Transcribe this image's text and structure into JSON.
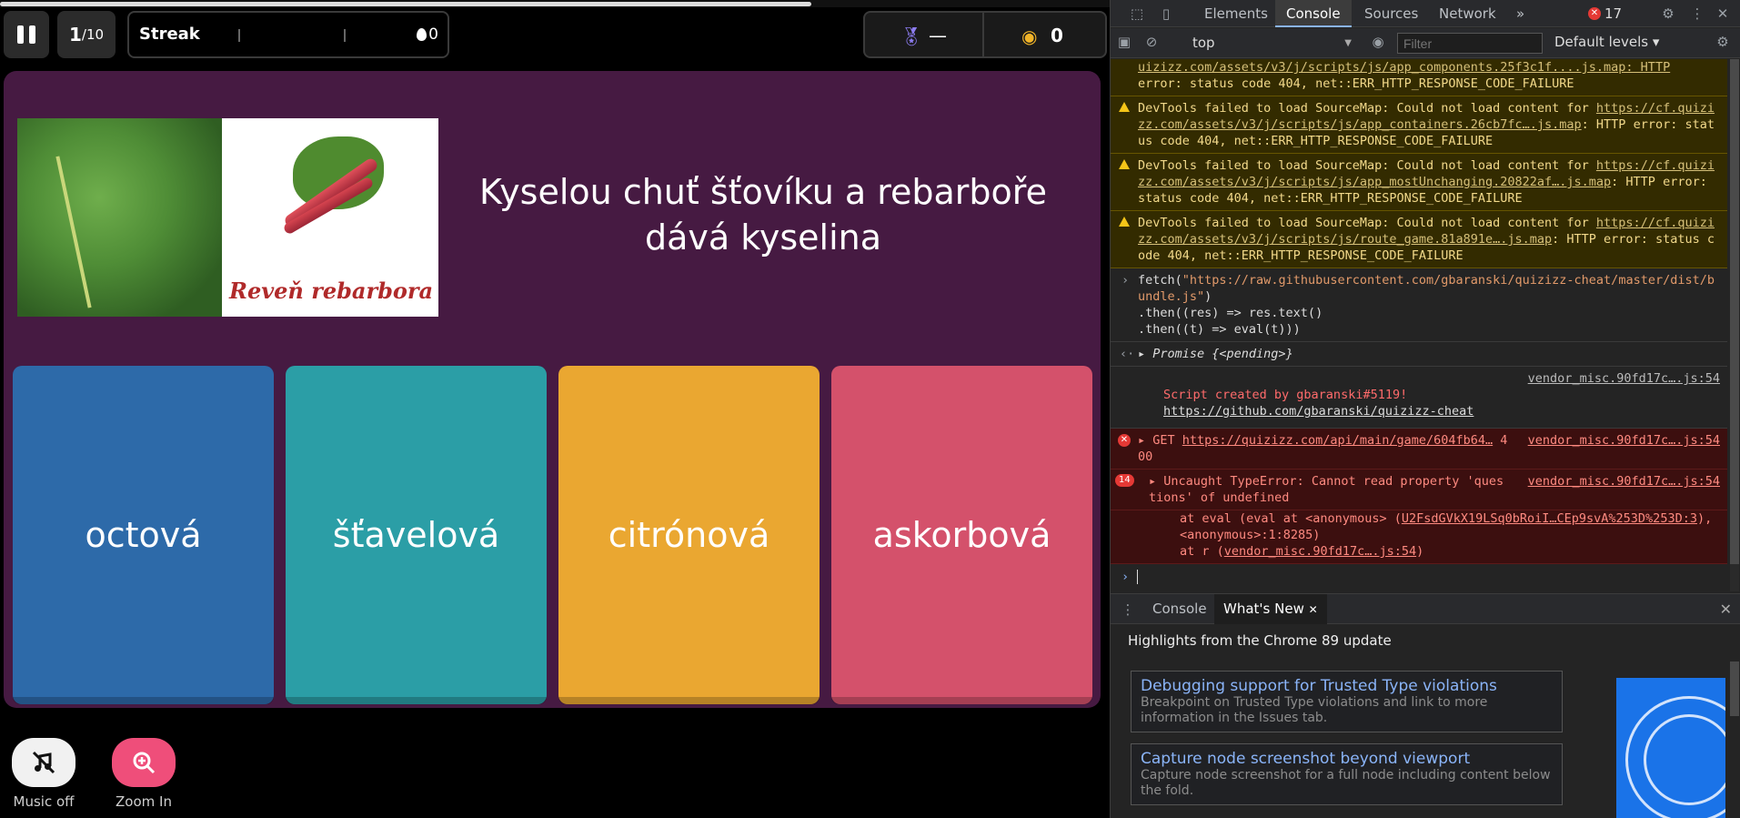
{
  "game": {
    "progress": 0.731,
    "question_counter": {
      "current": "1",
      "total": "/10"
    },
    "streak": {
      "label": "Streak",
      "count": "0"
    },
    "rank": "—",
    "coins": "0",
    "question": "Kyselou chuť šťovíku a rebarboře dává kyselina",
    "image_caption": "Reveň rebarbora",
    "answers": [
      "octová",
      "šťavelová",
      "citrónová",
      "askorbová"
    ],
    "answer_colors": [
      "#2d6aa9",
      "#2b9ea6",
      "#eaa731",
      "#d4516b"
    ],
    "music_label": "Music off",
    "zoom_label": "Zoom In"
  },
  "devtools": {
    "tabs": [
      "Elements",
      "Console",
      "Sources",
      "Network"
    ],
    "active_tab": "Console",
    "more_tabs": "»",
    "error_count": "17",
    "context": "top",
    "filter_placeholder": "Filter",
    "levels": "Default levels",
    "console": {
      "partial_line_1": "uizizz.com/assets/v3/j/scripts/js/app_components.25f3c1f....js.map: HTTP",
      "partial_line_2": "error: status code 404, net::ERR_HTTP_RESPONSE_CODE_FAILURE",
      "warnings": [
        {
          "prefix": "DevTools failed to load SourceMap: Could not load content for ",
          "link": "https://cf.quizizz.com/assets/v3/j/scripts/js/app_containers.26cb7fc….js.map",
          "suffix": ": HTTP error: status code 404, net::ERR_HTTP_RESPONSE_CODE_FAILURE"
        },
        {
          "prefix": "DevTools failed to load SourceMap: Could not load content for ",
          "link": "https://cf.quizizz.com/assets/v3/j/scripts/js/app_mostUnchanging.20822af….js.map",
          "suffix": ": HTTP error: status code 404, net::ERR_HTTP_RESPONSE_CODE_FAILURE"
        },
        {
          "prefix": "DevTools failed to load SourceMap: Could not load content for ",
          "link": "https://cf.quizizz.com/assets/v3/j/scripts/js/route_game.81a891e….js.map",
          "suffix": ": HTTP error: status code 404, net::ERR_HTTP_RESPONSE_CODE_FAILURE"
        }
      ],
      "input": {
        "fetch": "fetch(",
        "url": "\"https://raw.githubusercontent.com/gbaranski/quizizz-cheat/master/dist/bundle.js\"",
        "close": ")",
        "then1": ".then((res) => res.text()",
        "then2": ".then((t) => eval(t)))"
      },
      "result": "Promise {<pending>}",
      "log": {
        "source": "vendor_misc.90fd17c….js:54",
        "line1": "Script created by gbaranski#5119!",
        "line2": "https://github.com/gbaranski/quizizz-cheat"
      },
      "get_error": {
        "text": "GET ",
        "link": "https://quizizz.com/api/main/game/604fb64…",
        "status": " 400",
        "source": "vendor_misc.90fd17c….js:54"
      },
      "type_error": {
        "count": "14",
        "line1": "Uncaught TypeError: Cannot read property 'questions' of undefined",
        "line2a": "at eval (eval at <anonymous> (",
        "line2link": "U2FsdGVkX19LSq0bRoiI…CEp9svA%253D%253D:3",
        "line2b": "), <anonymous>:1:8285)",
        "line3a": "at r (",
        "line3link": "vendor_misc.90fd17c….js:54",
        "line3b": ")",
        "source": "vendor_misc.90fd17c….js:54"
      }
    },
    "drawer": {
      "tabs": [
        "Console",
        "What's New"
      ],
      "active": "What's New",
      "heading": "Highlights from the Chrome 89 update",
      "cards": [
        {
          "title": "Debugging support for Trusted Type violations",
          "desc": "Breakpoint on Trusted Type violations and link to more information in the Issues tab."
        },
        {
          "title": "Capture node screenshot beyond viewport",
          "desc": "Capture node screenshot for a full node including content below the fold."
        }
      ]
    }
  }
}
